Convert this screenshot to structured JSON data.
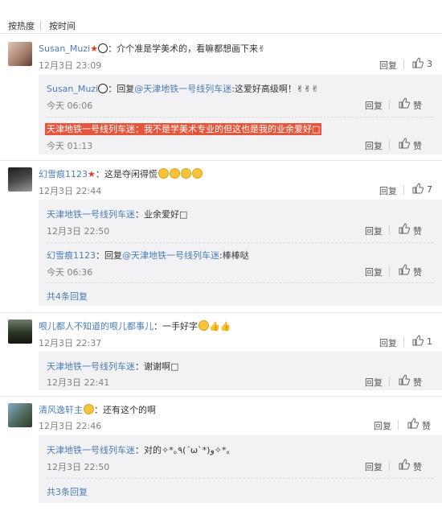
{
  "tabs": [
    "按热度",
    "按时间"
  ],
  "like_label": "赞",
  "reply_label": "回复",
  "c1": {
    "name": "Susan_Muzi",
    "text": "：介个准是学美术的，看嘛都想画下来",
    "time": "12月3日 23:09",
    "likes": "3",
    "replies": [
      {
        "name": "Susan_Muzi",
        "prefix": "：回复",
        "mention": "@天津地铁一号线列车迷",
        "text": ":这爱好高级啊！",
        "time": "今天 06:06"
      },
      {
        "name": "天津地铁一号线列车迷",
        "text": "：我不是学美术专业的但这也是我的业余爱好□",
        "time": "今天 01:13"
      }
    ]
  },
  "c2": {
    "name": "幻雪痕1123",
    "text": "：这是夺闲得慌",
    "time": "12月3日 22:44",
    "likes": "7",
    "replies": [
      {
        "name": "天津地铁一号线列车迷",
        "text": "：业余爱好□",
        "time": "12月3日 22:50"
      },
      {
        "name": "幻雪痕1123",
        "prefix": "：回复",
        "mention": "@天津地铁一号线列车迷",
        "text": ":棒棒哒",
        "time": "今天 06:36"
      }
    ],
    "more": "共4条回复"
  },
  "c3": {
    "name": "哏儿都人不知道的哏儿都事儿",
    "text": "：一手好字",
    "time": "12月3日 22:37",
    "likes": "1",
    "replies": [
      {
        "name": "天津地铁一号线列车迷",
        "text": "：谢谢啊□",
        "time": "12月3日 22:41"
      }
    ]
  },
  "c4": {
    "name": "清风逸轩主",
    "text": "：还有这个的啊",
    "time": "12月3日 22:46",
    "replies": [
      {
        "name": "天津地铁一号线列车迷",
        "text": "：对的✧*｡٩(ˊωˋ*)و✧*｡",
        "time": "12月3日 22:50"
      }
    ],
    "more": "共3条回复"
  },
  "colors": {
    "link": "#4a7cb4",
    "highlight": "#e5573c",
    "reply_bg": "#f2f2f5"
  }
}
